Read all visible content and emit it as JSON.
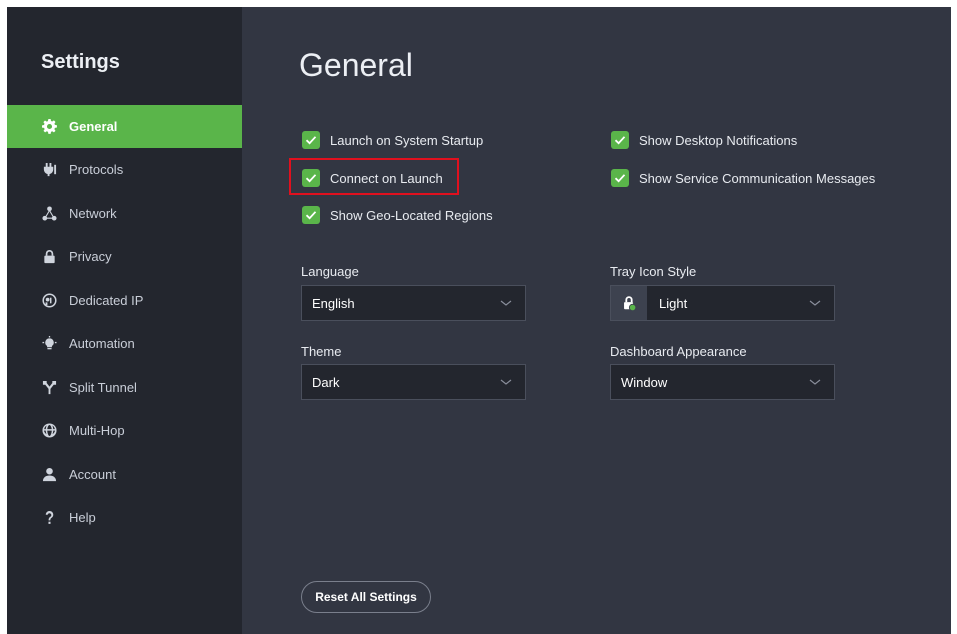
{
  "sidebar": {
    "title": "Settings",
    "items": [
      {
        "label": "General",
        "icon": "gear-icon",
        "active": true
      },
      {
        "label": "Protocols",
        "icon": "plug-icon"
      },
      {
        "label": "Network",
        "icon": "network-icon"
      },
      {
        "label": "Privacy",
        "icon": "lock-icon"
      },
      {
        "label": "Dedicated IP",
        "icon": "dedicated-ip-icon"
      },
      {
        "label": "Automation",
        "icon": "lightbulb-icon"
      },
      {
        "label": "Split Tunnel",
        "icon": "split-icon"
      },
      {
        "label": "Multi-Hop",
        "icon": "globe-icon"
      },
      {
        "label": "Account",
        "icon": "person-icon"
      },
      {
        "label": "Help",
        "icon": "question-icon"
      }
    ]
  },
  "main": {
    "title": "General",
    "checkboxes": {
      "launch_startup": {
        "label": "Launch on System Startup",
        "checked": true
      },
      "connect_launch": {
        "label": "Connect on Launch",
        "checked": true
      },
      "geo_regions": {
        "label": "Show Geo-Located Regions",
        "checked": true
      },
      "desktop_notifications": {
        "label": "Show Desktop Notifications",
        "checked": true
      },
      "service_messages": {
        "label": "Show Service Communication Messages",
        "checked": true
      }
    },
    "language": {
      "label": "Language",
      "value": "English"
    },
    "theme": {
      "label": "Theme",
      "value": "Dark"
    },
    "tray_icon_style": {
      "label": "Tray Icon Style",
      "value": "Light"
    },
    "dashboard_appearance": {
      "label": "Dashboard Appearance",
      "value": "Window"
    },
    "reset_label": "Reset All Settings"
  },
  "colors": {
    "accent": "#5ab54a",
    "sidebar_bg": "#23262e",
    "main_bg": "#323642",
    "highlight": "#e0101e"
  }
}
